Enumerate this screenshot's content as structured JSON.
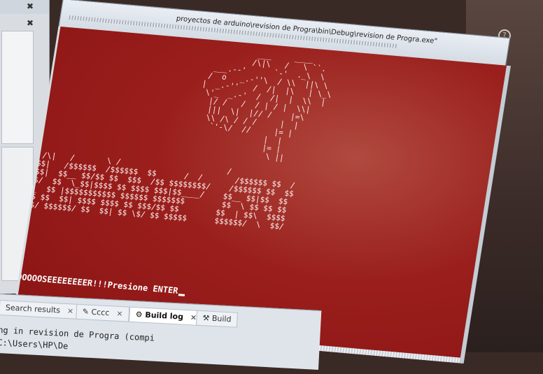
{
  "window": {
    "title": "proyectos de arduino\\revision de Progra\\bin\\Debug\\revision de Progra.exe\""
  },
  "console": {
    "ascii_dragon": "             ___     ____\n            /\\|\\   /   \\ ``.\n    ___.--'      `-'  ._\\  \\\n   /  o   _.-''\\  / \\\\  ||\\ \\\n  |  _.-''   /  /|  |\\   | \\_\\\n   \\'_  _.-'  /  /|  |  \\\\  |\n    |/ /   /  / | / |  \\\\|\n    |||  \\|  |// /    |=\\\n    \\\\ /\\ / / /     |  |\n     `'-\\/  //     |= |\n                 |  |\n                 |= |\n                  \\ ||",
    "ascii_game_over": "  /\\|   /       \\ /                       /\n $$|   /$$$$$$  /$$$$$$  $$      /  /       /$$$$$$ $$  /\n $$|  $$__ $$/$$ $$  $$$  /$$ $$$$$$$$/    /$$$$$$ $$  $$\n$$/  $$  \\_$$|$$$$ $$ $$$$ $$$|$$____/    $$__ $$|$$  $$\n _  $$ |$$$$$$$$$$$ $$$$$$ $$$$$$$        $$  \\ $$ $$ $$\n$$ $$  $$| $$$$ $$$$ $$ $$$/$$ $$        $$  | $$\\  $$$$\n$$/ $$$$$$/ $$  $$| $$ \\$/ $$ $$$$$      $$$$$$/  \\  $$/",
    "prompt": "LOOOOOOSEEEEEEEER!!!Presione ENTER"
  },
  "desktop": {
    "help_icon": "?",
    "back_arrow": "←"
  },
  "ide": {
    "left_close_1": "✖",
    "left_close_2": "✖",
    "tabs": [
      {
        "label": "Search results",
        "icon": "search-icon"
      },
      {
        "label": "Cccc",
        "icon": "pencil-icon"
      },
      {
        "label": "Build log",
        "icon": "gear-icon"
      },
      {
        "label": "Build",
        "icon": "hammer-icon"
      }
    ],
    "output_lines": [
      "ng in revision de Progra (compi",
      "C:\\Users\\HP\\De"
    ]
  }
}
